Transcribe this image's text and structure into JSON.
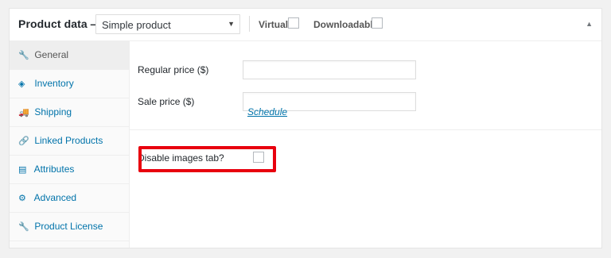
{
  "header": {
    "title": "Product data —",
    "product_type": "Simple product",
    "virtual_label": "Virtual:",
    "downloadable_label": "Downloadable:",
    "toggle_glyph": "▲"
  },
  "sidebar": {
    "items": [
      {
        "label": "General",
        "icon": "wrench-icon",
        "glyph": "🔧",
        "active": true
      },
      {
        "label": "Inventory",
        "icon": "tag-icon",
        "glyph": "◈",
        "active": false
      },
      {
        "label": "Shipping",
        "icon": "truck-icon",
        "glyph": "🚚",
        "active": false
      },
      {
        "label": "Linked Products",
        "icon": "link-icon",
        "glyph": "🔗",
        "active": false
      },
      {
        "label": "Attributes",
        "icon": "list-icon",
        "glyph": "▤",
        "active": false
      },
      {
        "label": "Advanced",
        "icon": "gear-icon",
        "glyph": "⚙",
        "active": false
      },
      {
        "label": "Product License",
        "icon": "wrench-icon",
        "glyph": "🔧",
        "active": false
      }
    ]
  },
  "general": {
    "regular_price_label": "Regular price ($)",
    "regular_price_value": "",
    "sale_price_label": "Sale price ($)",
    "sale_price_value": "",
    "schedule_link": "Schedule",
    "disable_images_label": "Disable images tab?"
  },
  "colors": {
    "link": "#0073aa",
    "highlight": "#e8000e"
  }
}
